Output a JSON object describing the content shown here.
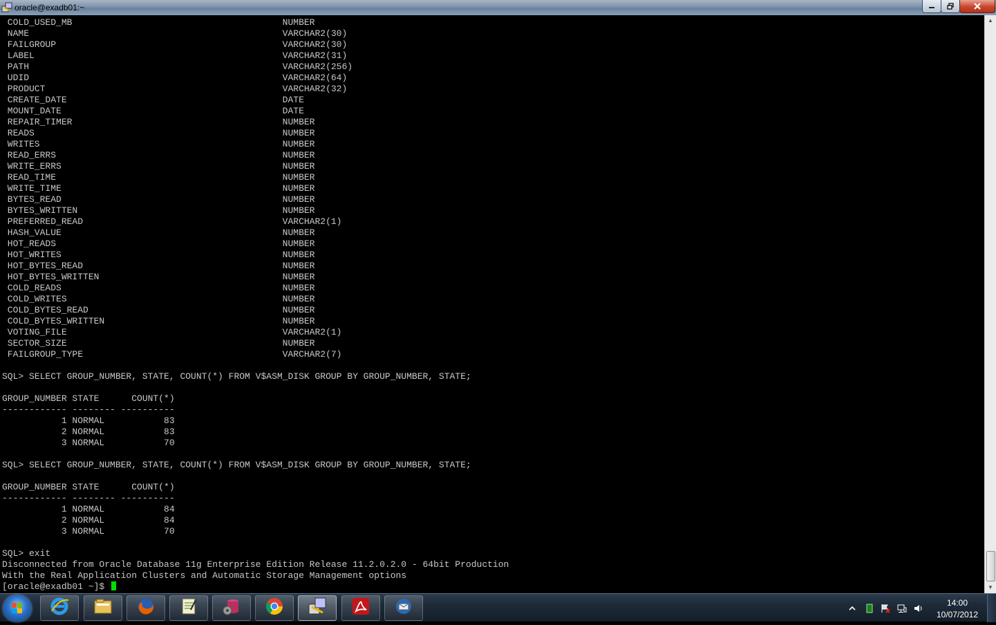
{
  "window": {
    "title": "oracle@exadb01:~"
  },
  "terminal": {
    "lines": [
      " COLD_USED_MB                                       NUMBER",
      " NAME                                               VARCHAR2(30)",
      " FAILGROUP                                          VARCHAR2(30)",
      " LABEL                                              VARCHAR2(31)",
      " PATH                                               VARCHAR2(256)",
      " UDID                                               VARCHAR2(64)",
      " PRODUCT                                            VARCHAR2(32)",
      " CREATE_DATE                                        DATE",
      " MOUNT_DATE                                         DATE",
      " REPAIR_TIMER                                       NUMBER",
      " READS                                              NUMBER",
      " WRITES                                             NUMBER",
      " READ_ERRS                                          NUMBER",
      " WRITE_ERRS                                         NUMBER",
      " READ_TIME                                          NUMBER",
      " WRITE_TIME                                         NUMBER",
      " BYTES_READ                                         NUMBER",
      " BYTES_WRITTEN                                      NUMBER",
      " PREFERRED_READ                                     VARCHAR2(1)",
      " HASH_VALUE                                         NUMBER",
      " HOT_READS                                          NUMBER",
      " HOT_WRITES                                         NUMBER",
      " HOT_BYTES_READ                                     NUMBER",
      " HOT_BYTES_WRITTEN                                  NUMBER",
      " COLD_READS                                         NUMBER",
      " COLD_WRITES                                        NUMBER",
      " COLD_BYTES_READ                                    NUMBER",
      " COLD_BYTES_WRITTEN                                 NUMBER",
      " VOTING_FILE                                        VARCHAR2(1)",
      " SECTOR_SIZE                                        NUMBER",
      " FAILGROUP_TYPE                                     VARCHAR2(7)",
      "",
      "SQL> SELECT GROUP_NUMBER, STATE, COUNT(*) FROM V$ASM_DISK GROUP BY GROUP_NUMBER, STATE;",
      "",
      "GROUP_NUMBER STATE      COUNT(*)",
      "------------ -------- ----------",
      "           1 NORMAL           83",
      "           2 NORMAL           83",
      "           3 NORMAL           70",
      "",
      "SQL> SELECT GROUP_NUMBER, STATE, COUNT(*) FROM V$ASM_DISK GROUP BY GROUP_NUMBER, STATE;",
      "",
      "GROUP_NUMBER STATE      COUNT(*)",
      "------------ -------- ----------",
      "           1 NORMAL           84",
      "           2 NORMAL           84",
      "           3 NORMAL           70",
      "",
      "SQL> exit",
      "Disconnected from Oracle Database 11g Enterprise Edition Release 11.2.0.2.0 - 64bit Production",
      "With the Real Application Clusters and Automatic Storage Management options"
    ],
    "prompt": "[oracle@exadb01 ~]$ "
  },
  "taskbar": {
    "apps": [
      {
        "name": "internet-explorer-icon",
        "active": false
      },
      {
        "name": "file-explorer-icon",
        "active": false
      },
      {
        "name": "firefox-icon",
        "active": false
      },
      {
        "name": "notepad-icon",
        "active": false
      },
      {
        "name": "database-tool-icon",
        "active": false
      },
      {
        "name": "chrome-icon",
        "active": false
      },
      {
        "name": "putty-icon",
        "active": true
      },
      {
        "name": "acrobat-icon",
        "active": false
      },
      {
        "name": "thunderbird-icon",
        "active": false
      }
    ],
    "clock_time": "14:00",
    "clock_date": "10/07/2012"
  }
}
